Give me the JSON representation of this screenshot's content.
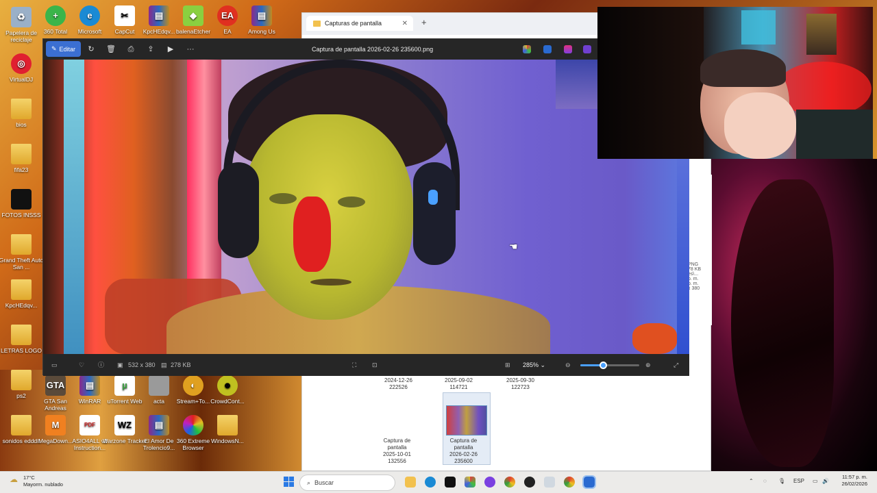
{
  "desktop": {
    "icons": [
      {
        "label": "Papelera de reciclaje",
        "icon": "recycle-bin-icon"
      },
      {
        "label": "360 Total",
        "icon": "360-total-icon"
      },
      {
        "label": "Microsoft",
        "icon": "edge-icon"
      },
      {
        "label": "CapCut",
        "icon": "capcut-icon"
      },
      {
        "label": "KpcHEdqv...",
        "icon": "winrar-icon"
      },
      {
        "label": "balenaEtcher",
        "icon": "balena-etcher-icon"
      },
      {
        "label": "EA",
        "icon": "ea-icon"
      },
      {
        "label": "Among Us",
        "icon": "among-us-icon"
      },
      {
        "label": "VirtualDJ",
        "icon": "virtualdj-icon"
      },
      {
        "label": "bios",
        "icon": "folder-icon"
      },
      {
        "label": "fifa23",
        "icon": "folder-icon"
      },
      {
        "label": "FOTOS INSSS",
        "icon": "folder-icon"
      },
      {
        "label": "Grand Theft Auto San ...",
        "icon": "folder-icon"
      },
      {
        "label": "KpcHEdqv...",
        "icon": "folder-icon"
      },
      {
        "label": "LETRAS LOGO",
        "icon": "folder-icon"
      },
      {
        "label": "ps2",
        "icon": "folder-icon"
      },
      {
        "label": "GTA San Andreas",
        "icon": "gta-icon"
      },
      {
        "label": "WinRAR",
        "icon": "winrar-icon"
      },
      {
        "label": "uTorrent Web",
        "icon": "utorrent-icon"
      },
      {
        "label": "acta",
        "icon": "document-icon"
      },
      {
        "label": "Stream+To...",
        "icon": "stream-icon"
      },
      {
        "label": "CrowdCont...",
        "icon": "crowdcontrol-icon"
      },
      {
        "label": "sonidos edddit",
        "icon": "folder-icon"
      },
      {
        "label": "MegaDown...",
        "icon": "megadownloader-icon"
      },
      {
        "label": "ASIO4ALL v2 Instruction...",
        "icon": "pdf-icon"
      },
      {
        "label": "Warzone Tracker",
        "icon": "warzone-icon"
      },
      {
        "label": "El Amor De Trolencio9...",
        "icon": "winrar-icon"
      },
      {
        "label": "360 Extreme Browser",
        "icon": "360-browser-icon"
      },
      {
        "label": "WindowsN...",
        "icon": "folder-icon"
      }
    ]
  },
  "explorer": {
    "tab_title": "Capturas de pantalla",
    "tab_close": "✕",
    "new_tab": "+",
    "files": [
      {
        "lines": [
          "2024-12-26",
          "222526"
        ]
      },
      {
        "lines": [
          "2025-09-02",
          "114721"
        ]
      },
      {
        "lines": [
          "2025-09-30",
          "122723"
        ]
      },
      {
        "lines": [
          "Captura de",
          "pantalla",
          "2025-10-01",
          "132556"
        ]
      },
      {
        "lines": [
          "Captura de",
          "pantalla",
          "2026-02-26",
          "235600"
        ]
      }
    ],
    "details": [
      "PNG",
      "78 KB",
      "es\\...",
      "p. m.",
      "p. m.",
      "x 380"
    ]
  },
  "viewer": {
    "edit_label": "Editar",
    "title": "Captura de pantalla 2026-02-26 235600.png",
    "more": "···",
    "dimensions": "532 x 380",
    "size": "278 KB",
    "zoom": "285%",
    "zoom_level_percent": 38
  },
  "taskbar": {
    "weather_temp": "17°C",
    "weather_desc": "Mayorm. nublado",
    "search_placeholder": "Buscar",
    "language": "ESP",
    "time": "11:57 p. m.",
    "date": "26/02/2026"
  },
  "colors": {
    "accent": "#3b6fd2",
    "viewer_bg": "#202020",
    "taskbar_bg": "#ecebe9"
  }
}
